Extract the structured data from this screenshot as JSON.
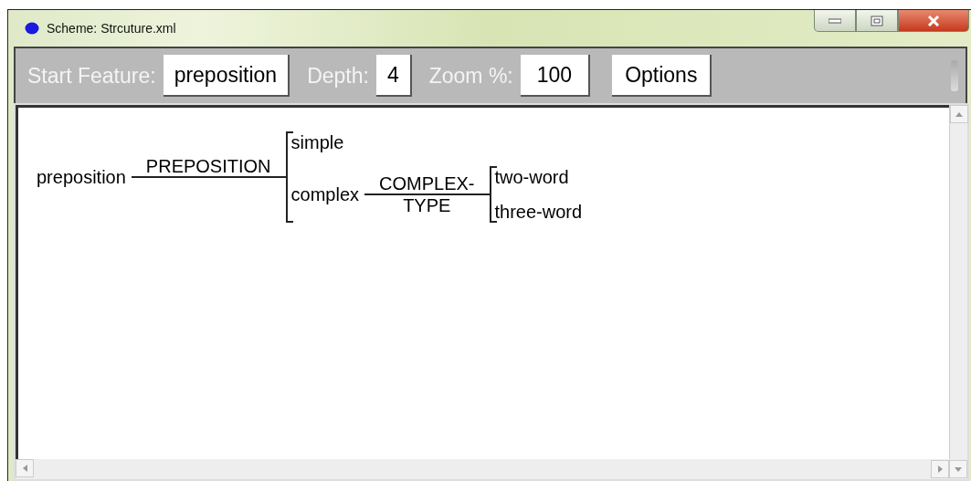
{
  "window": {
    "title": "Scheme: Strcuture.xml"
  },
  "toolbar": {
    "start_feature": {
      "label": "Start Feature:",
      "value": "preposition"
    },
    "depth": {
      "label": "Depth:",
      "value": "4"
    },
    "zoom": {
      "label": "Zoom %:",
      "value": "100"
    },
    "options_button": "Options"
  },
  "tree": {
    "label": "preposition",
    "feature": [
      "PREPOSITION"
    ],
    "children": [
      {
        "label": "simple"
      },
      {
        "label": "complex",
        "feature": [
          "COMPLEX-",
          "TYPE"
        ],
        "children": [
          {
            "label": "two-word"
          },
          {
            "label": "three-word"
          }
        ]
      }
    ]
  }
}
